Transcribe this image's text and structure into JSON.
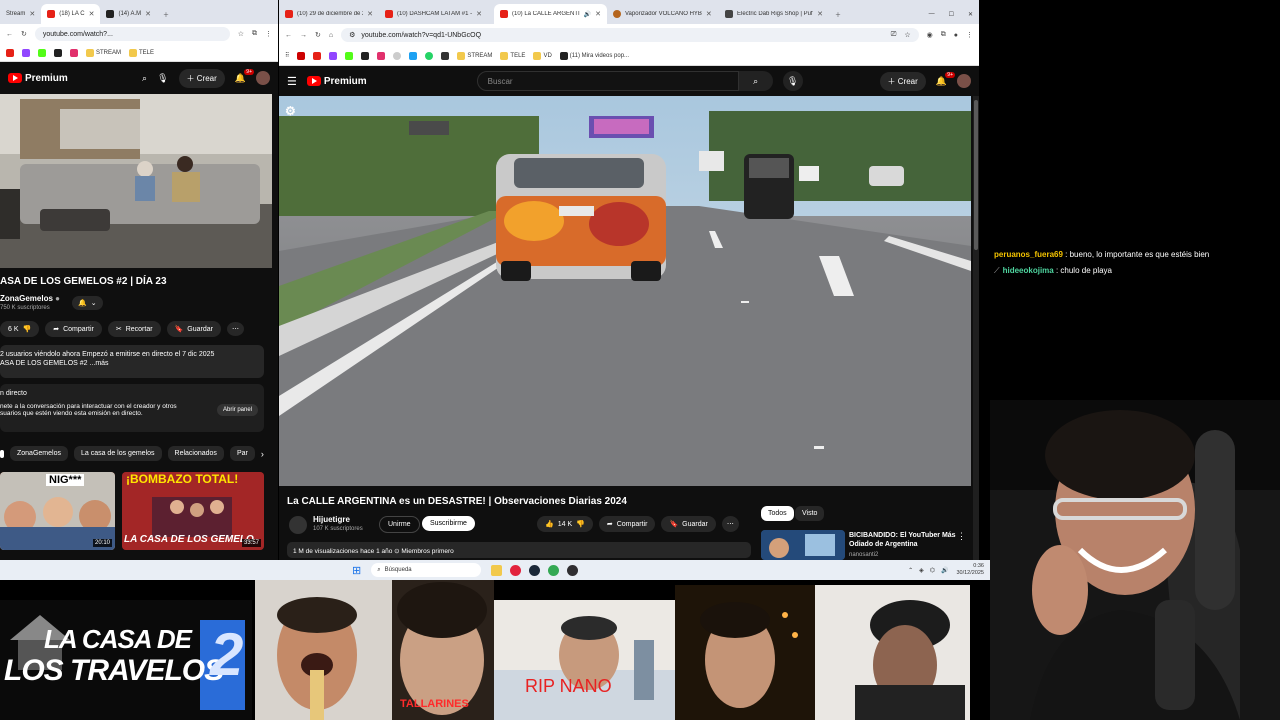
{
  "left_browser": {
    "tabs": [
      {
        "label": "Stream",
        "active": false
      },
      {
        "label": "(18) LA C",
        "active": true
      },
      {
        "label": "(14) A.M",
        "active": false
      }
    ],
    "url": "youtube.com/watch?...",
    "bookmarks": [
      "STREAM",
      "TELE"
    ],
    "yt_logo": "Premium",
    "create_label": "Crear",
    "notif_count": "9+",
    "video_title": "ASA DE LOS GEMELOS #2 | DÍA 23",
    "channel_name": "ZonaGemelos",
    "subscribers": "750 K suscriptores",
    "likes": "6 K",
    "share_label": "Compartir",
    "clip_label": "Recortar",
    "save_label": "Guardar",
    "desc_line1": "2 usuarios viéndolo ahora  Empezó a emitirse en directo el 7 dic 2025",
    "desc_line2": "ASA DE LOS GEMELOS #2 ...más",
    "live_chat_title": "n directo",
    "live_chat_text1": "nete a la conversación para interactuar con el creador y otros",
    "live_chat_text2": "suarios que estén viendo esta emisión en directo.",
    "open_panel_label": "Abrir panel",
    "chips": [
      "ZonaGemelos",
      "La casa de los gemelos",
      "Relacionados",
      "Par"
    ],
    "thumb1_text": "NIG***",
    "thumb1_duration": "20:10",
    "thumb2_title": "¡BOMBAZO TOTAL!",
    "thumb2_text": "LA CASA DE LOS GEMELO",
    "thumb2_duration": "33:57"
  },
  "right_browser": {
    "tabs": [
      {
        "label": "(10) 29 de diciembre de 2025",
        "active": false
      },
      {
        "label": "(10) DASHCAM LATAM #1 -",
        "active": false
      },
      {
        "label": "(10) La CALLE ARGENTIN",
        "active": true
      },
      {
        "label": "Vaporizador VOLCANO HYB",
        "active": false
      },
      {
        "label": "Electric Dab Rigs Shop | Puff",
        "active": false
      }
    ],
    "url": "youtube.com/watch?v=qd1-UNbGcOQ",
    "bookmarks": [
      "STREAM",
      "TELE",
      "VD",
      "(11) Mira videos pop..."
    ],
    "yt_logo": "Premium",
    "search_placeholder": "Buscar",
    "create_label": "Crear",
    "notif_count": "9+",
    "video_title": "La CALLE ARGENTINA es un DESASTRE! | Observaciones Diarias 2024",
    "channel_name": "Hijuetigre",
    "subscribers": "107 K suscriptores",
    "join_label": "Unirme",
    "subscribe_label": "Suscribirme",
    "likes": "14 K",
    "share_label": "Compartir",
    "save_label": "Guardar",
    "filter_all": "Todos",
    "filter_seen": "Visto",
    "views_line": "1 M de visualizaciones  hace 1 año  ⊙ Miembros primero",
    "rec_title1": "BICIBANDIDO: El YouTuber Más",
    "rec_title2": "Odiado de Argentina",
    "rec_channel": "nanosanti2"
  },
  "taskbar": {
    "search_placeholder": "Búsqueda",
    "time": "0:36",
    "date": "30/12/2025"
  },
  "chat": [
    {
      "user": "peruanos_fuera69",
      "color": "#f5c400",
      "message": " : bueno, lo importante es que estéis bien"
    },
    {
      "user": "hideeokojima",
      "color": "#4fd6a0",
      "message": " : chulo de playa"
    }
  ],
  "strip": {
    "logo_line1": "LA CASA DE",
    "logo_line2": "LOS TRAVELOS",
    "logo_number": "2",
    "caption1": "TALLARINES",
    "caption2": "RIP NANO"
  },
  "colors": {
    "yt_red": "#ff0000",
    "yt_bg": "#0f0f0f",
    "chip_bg": "#272727"
  }
}
